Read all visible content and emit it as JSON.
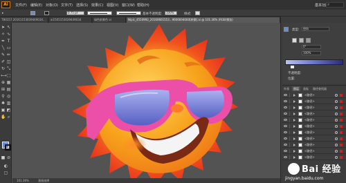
{
  "app": {
    "logo_text": "Ai"
  },
  "menu": {
    "items": [
      "文件(F)",
      "编辑(E)",
      "对象(O)",
      "文字(T)",
      "选择(S)",
      "效果(C)",
      "视图(V)",
      "窗口(W)",
      "帮助(H)"
    ],
    "workspace": "基本功能"
  },
  "controlbar": {
    "stroke_weight": "0.75 pt",
    "brush": "基本",
    "opacity_label": "不透明度:",
    "opacity_value": "100%",
    "style_label": "样式:"
  },
  "tabs": [
    "TB0157.20161153039449034...",
    "ai1505153039449034",
    "绿色前景色 ai",
    "Nipic_4550992_20160601553...9606694000[转换].ai @ 101.36% (RGB/预览)"
  ],
  "active_tab_index": 3,
  "color_panel": {
    "type_label": "类型:",
    "type_value": "径向",
    "angle_value": "0°",
    "ratio_value": "100%",
    "opacity_label": "不透明度:",
    "location_label": "位置:",
    "gradient_colors": [
      "#b8c4ef",
      "#6a75c8",
      "#2d2b7a"
    ]
  },
  "layers_panel": {
    "tabs": [
      "外观",
      "图层",
      "画板",
      "路径查找器"
    ],
    "active_tab": 1,
    "rows": [
      "<路径>",
      "<路径>",
      "<路径>",
      "<路径>",
      "<路径>",
      "<路径>",
      "<路径>",
      "<路径>",
      "<路径>",
      "<路径>",
      "<路径>",
      "<路径>"
    ]
  },
  "statusbar": {
    "zoom": "101.36%",
    "mode": "直接选择"
  },
  "colors": {
    "sun_outer": "#e8341c",
    "sun_inner": "#f7a21b",
    "face": "#f5b93b",
    "glasses_frame": "#ec4fa8",
    "lens": "#7c84d8",
    "accent": "#6a8bd2"
  },
  "watermark": {
    "brand": "Bai 经验",
    "url": "jingyan.baidu.com"
  }
}
